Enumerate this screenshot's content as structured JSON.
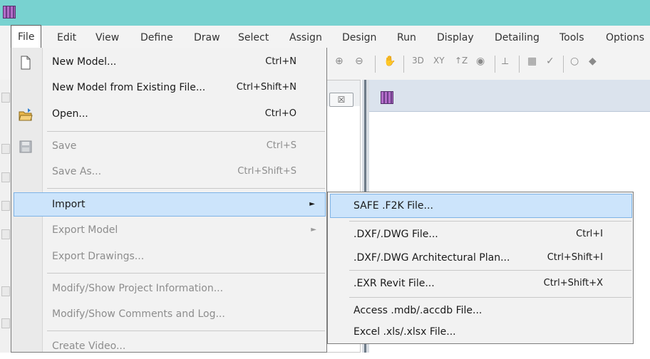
{
  "menubar": {
    "items": [
      "File",
      "Edit",
      "View",
      "Define",
      "Draw",
      "Select",
      "Assign",
      "Design",
      "Run",
      "Display",
      "Detailing",
      "Tools",
      "Options"
    ]
  },
  "toolbar": {
    "labels": [
      "3D",
      "XY",
      "↑Z"
    ]
  },
  "panel": {
    "close_glyph": "☒"
  },
  "file_menu": {
    "items": [
      {
        "label": "New Model...",
        "shortcut": "Ctrl+N",
        "icon": "new-document-icon",
        "enabled": true
      },
      {
        "label": "New Model from Existing File...",
        "shortcut": "Ctrl+Shift+N",
        "icon": "",
        "enabled": true
      },
      {
        "label": "Open...",
        "shortcut": "Ctrl+O",
        "icon": "open-folder-icon",
        "enabled": true
      },
      {
        "label": "Save",
        "shortcut": "Ctrl+S",
        "icon": "save-disk-icon",
        "enabled": false
      },
      {
        "label": "Save As...",
        "shortcut": "Ctrl+Shift+S",
        "icon": "",
        "enabled": false
      },
      {
        "label": "Import",
        "shortcut": "",
        "icon": "",
        "enabled": true,
        "submenu": true,
        "highlighted": true
      },
      {
        "label": "Export Model",
        "shortcut": "",
        "icon": "",
        "enabled": false,
        "submenu": true
      },
      {
        "label": "Export Drawings...",
        "shortcut": "",
        "icon": "",
        "enabled": false
      },
      {
        "label": "Modify/Show Project Information...",
        "shortcut": "",
        "icon": "",
        "enabled": false
      },
      {
        "label": "Modify/Show Comments and Log...",
        "shortcut": "",
        "icon": "",
        "enabled": false
      },
      {
        "label": "Create Video...",
        "shortcut": "",
        "icon": "",
        "enabled": false
      }
    ],
    "submenu_arrow": "►"
  },
  "import_submenu": {
    "items": [
      {
        "label": "SAFE .F2K File...",
        "shortcut": "",
        "highlighted": true
      },
      {
        "label": ".DXF/.DWG File...",
        "shortcut": "Ctrl+I"
      },
      {
        "label": ".DXF/.DWG Architectural Plan...",
        "shortcut": "Ctrl+Shift+I"
      },
      {
        "label": ".EXR Revit File...",
        "shortcut": "Ctrl+Shift+X"
      },
      {
        "label": "Access .mdb/.accdb File...",
        "shortcut": ""
      },
      {
        "label": "Excel .xls/.xlsx File...",
        "shortcut": ""
      }
    ]
  },
  "colors": {
    "titlebar": "#78d2d0",
    "highlight": "#cce4fb",
    "highlight_border": "#7eb3e6"
  }
}
